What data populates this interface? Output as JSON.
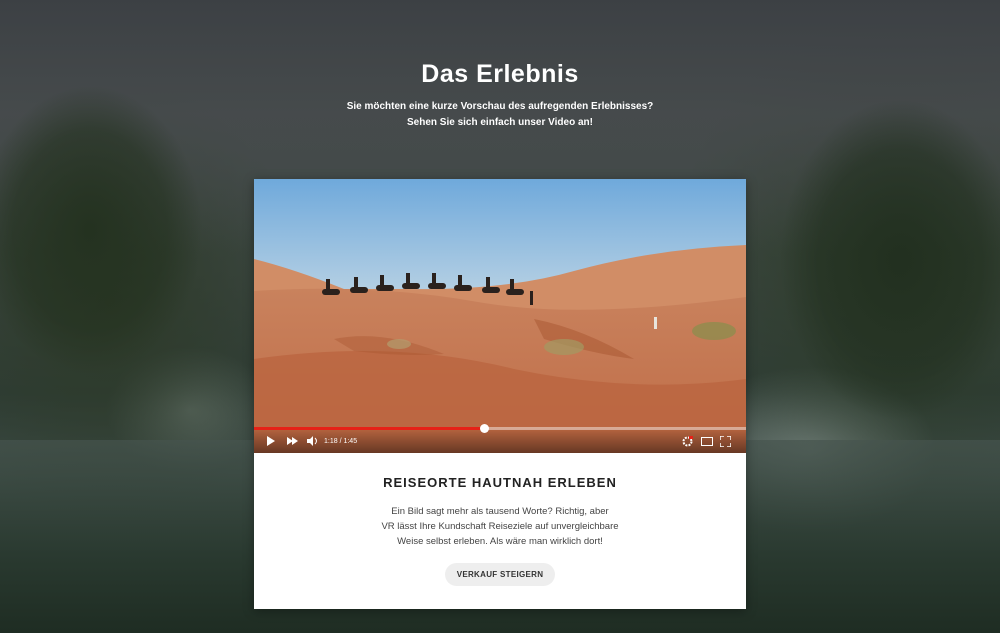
{
  "section": {
    "title": "Das Erlebnis",
    "subtitle_line1": "Sie möchten eine kurze Vorschau des aufregenden Erlebnisses?",
    "subtitle_line2": "Sehen Sie sich einfach unser Video an!"
  },
  "video": {
    "time_display": "1:18 / 1:45",
    "progress_fraction": 0.468,
    "progress_color": "#e62117",
    "icons": [
      "play-icon",
      "next-icon",
      "volume-icon",
      "settings-icon",
      "theater-mode-icon",
      "fullscreen-icon"
    ]
  },
  "card": {
    "title": "REISEORTE HAUTNAH ERLEBEN",
    "text_line1": "Ein Bild sagt mehr als tausend Worte? Richtig, aber",
    "text_line2": "VR lässt Ihre Kundschaft Reiseziele auf unvergleichbare",
    "text_line3": "Weise selbst erleben. Als wäre man wirklich dort!",
    "cta_label": "VERKAUF STEIGERN"
  }
}
